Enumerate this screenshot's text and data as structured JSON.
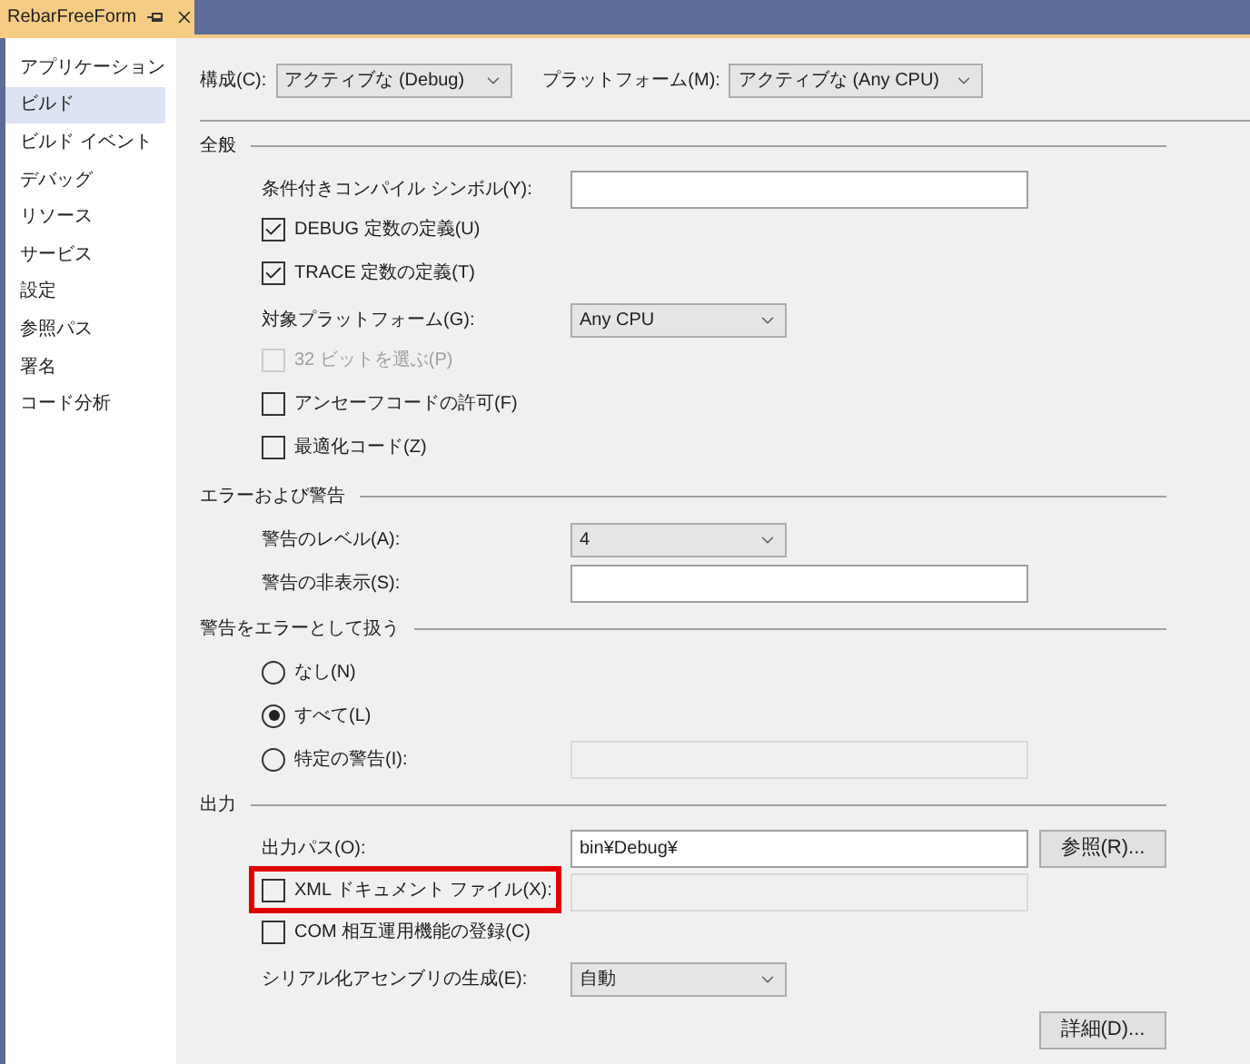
{
  "tab": {
    "title": "RebarFreeForm"
  },
  "sidebar": {
    "items": [
      {
        "label": "アプリケーション",
        "selected": false
      },
      {
        "label": "ビルド",
        "selected": true
      },
      {
        "label": "ビルド イベント",
        "selected": false
      },
      {
        "label": "デバッグ",
        "selected": false
      },
      {
        "label": "リソース",
        "selected": false
      },
      {
        "label": "サービス",
        "selected": false
      },
      {
        "label": "設定",
        "selected": false
      },
      {
        "label": "参照パス",
        "selected": false
      },
      {
        "label": "署名",
        "selected": false
      },
      {
        "label": "コード分析",
        "selected": false
      }
    ]
  },
  "toolbar": {
    "configuration": {
      "label": "構成(C):",
      "value": "アクティブな (Debug)"
    },
    "platform": {
      "label": "プラットフォーム(M):",
      "value": "アクティブな (Any CPU)"
    }
  },
  "sections": [
    {
      "title": "全般",
      "rows": [
        {
          "kind": "text",
          "label": "条件付きコンパイル シンボル(Y):",
          "field": {
            "disabled": false
          }
        },
        {
          "kind": "checkbox",
          "label": "DEBUG 定数の定義(U)",
          "checked": true,
          "disabled": false
        },
        {
          "kind": "checkbox",
          "label": "TRACE 定数の定義(T)",
          "checked": true,
          "disabled": false
        },
        {
          "kind": "dropdown",
          "label": "対象プラットフォーム(G):",
          "value": "Any CPU"
        },
        {
          "kind": "checkbox",
          "label": "32 ビットを選ぶ(P)",
          "checked": false,
          "disabled": true
        },
        {
          "kind": "checkbox",
          "label": "アンセーフコードの許可(F)",
          "checked": false,
          "disabled": false
        },
        {
          "kind": "checkbox",
          "label": "最適化コード(Z)",
          "checked": false,
          "disabled": false
        }
      ]
    },
    {
      "title": "エラーおよび警告",
      "rows": [
        {
          "kind": "dropdown",
          "label": "警告のレベル(A):",
          "value": "4"
        },
        {
          "kind": "text",
          "label": "警告の非表示(S):",
          "field": {
            "disabled": false
          }
        }
      ]
    },
    {
      "title": "警告をエラーとして扱う",
      "rows": [
        {
          "kind": "radio",
          "label": "なし(N)",
          "selected": false
        },
        {
          "kind": "radio",
          "label": "すべて(L)",
          "selected": true
        },
        {
          "kind": "radio",
          "label": "特定の警告(I):",
          "selected": false,
          "field": {
            "disabled": true
          }
        }
      ]
    },
    {
      "title": "出力",
      "rows": [
        {
          "kind": "text",
          "label": "出力パス(O):",
          "value": "bin¥Debug¥",
          "field": {
            "disabled": false
          },
          "button": "参照(R)..."
        },
        {
          "kind": "checkbox",
          "label": "XML ドキュメント ファイル(X):",
          "checked": false,
          "disabled": false,
          "highlighted": true,
          "field": {
            "disabled": true
          }
        },
        {
          "kind": "checkbox",
          "label": "COM 相互運用機能の登録(C)",
          "checked": false,
          "disabled": false
        },
        {
          "kind": "dropdown",
          "label": "シリアル化アセンブリの生成(E):",
          "value": "自動"
        }
      ]
    }
  ],
  "footer_button": "詳細(D)..."
}
